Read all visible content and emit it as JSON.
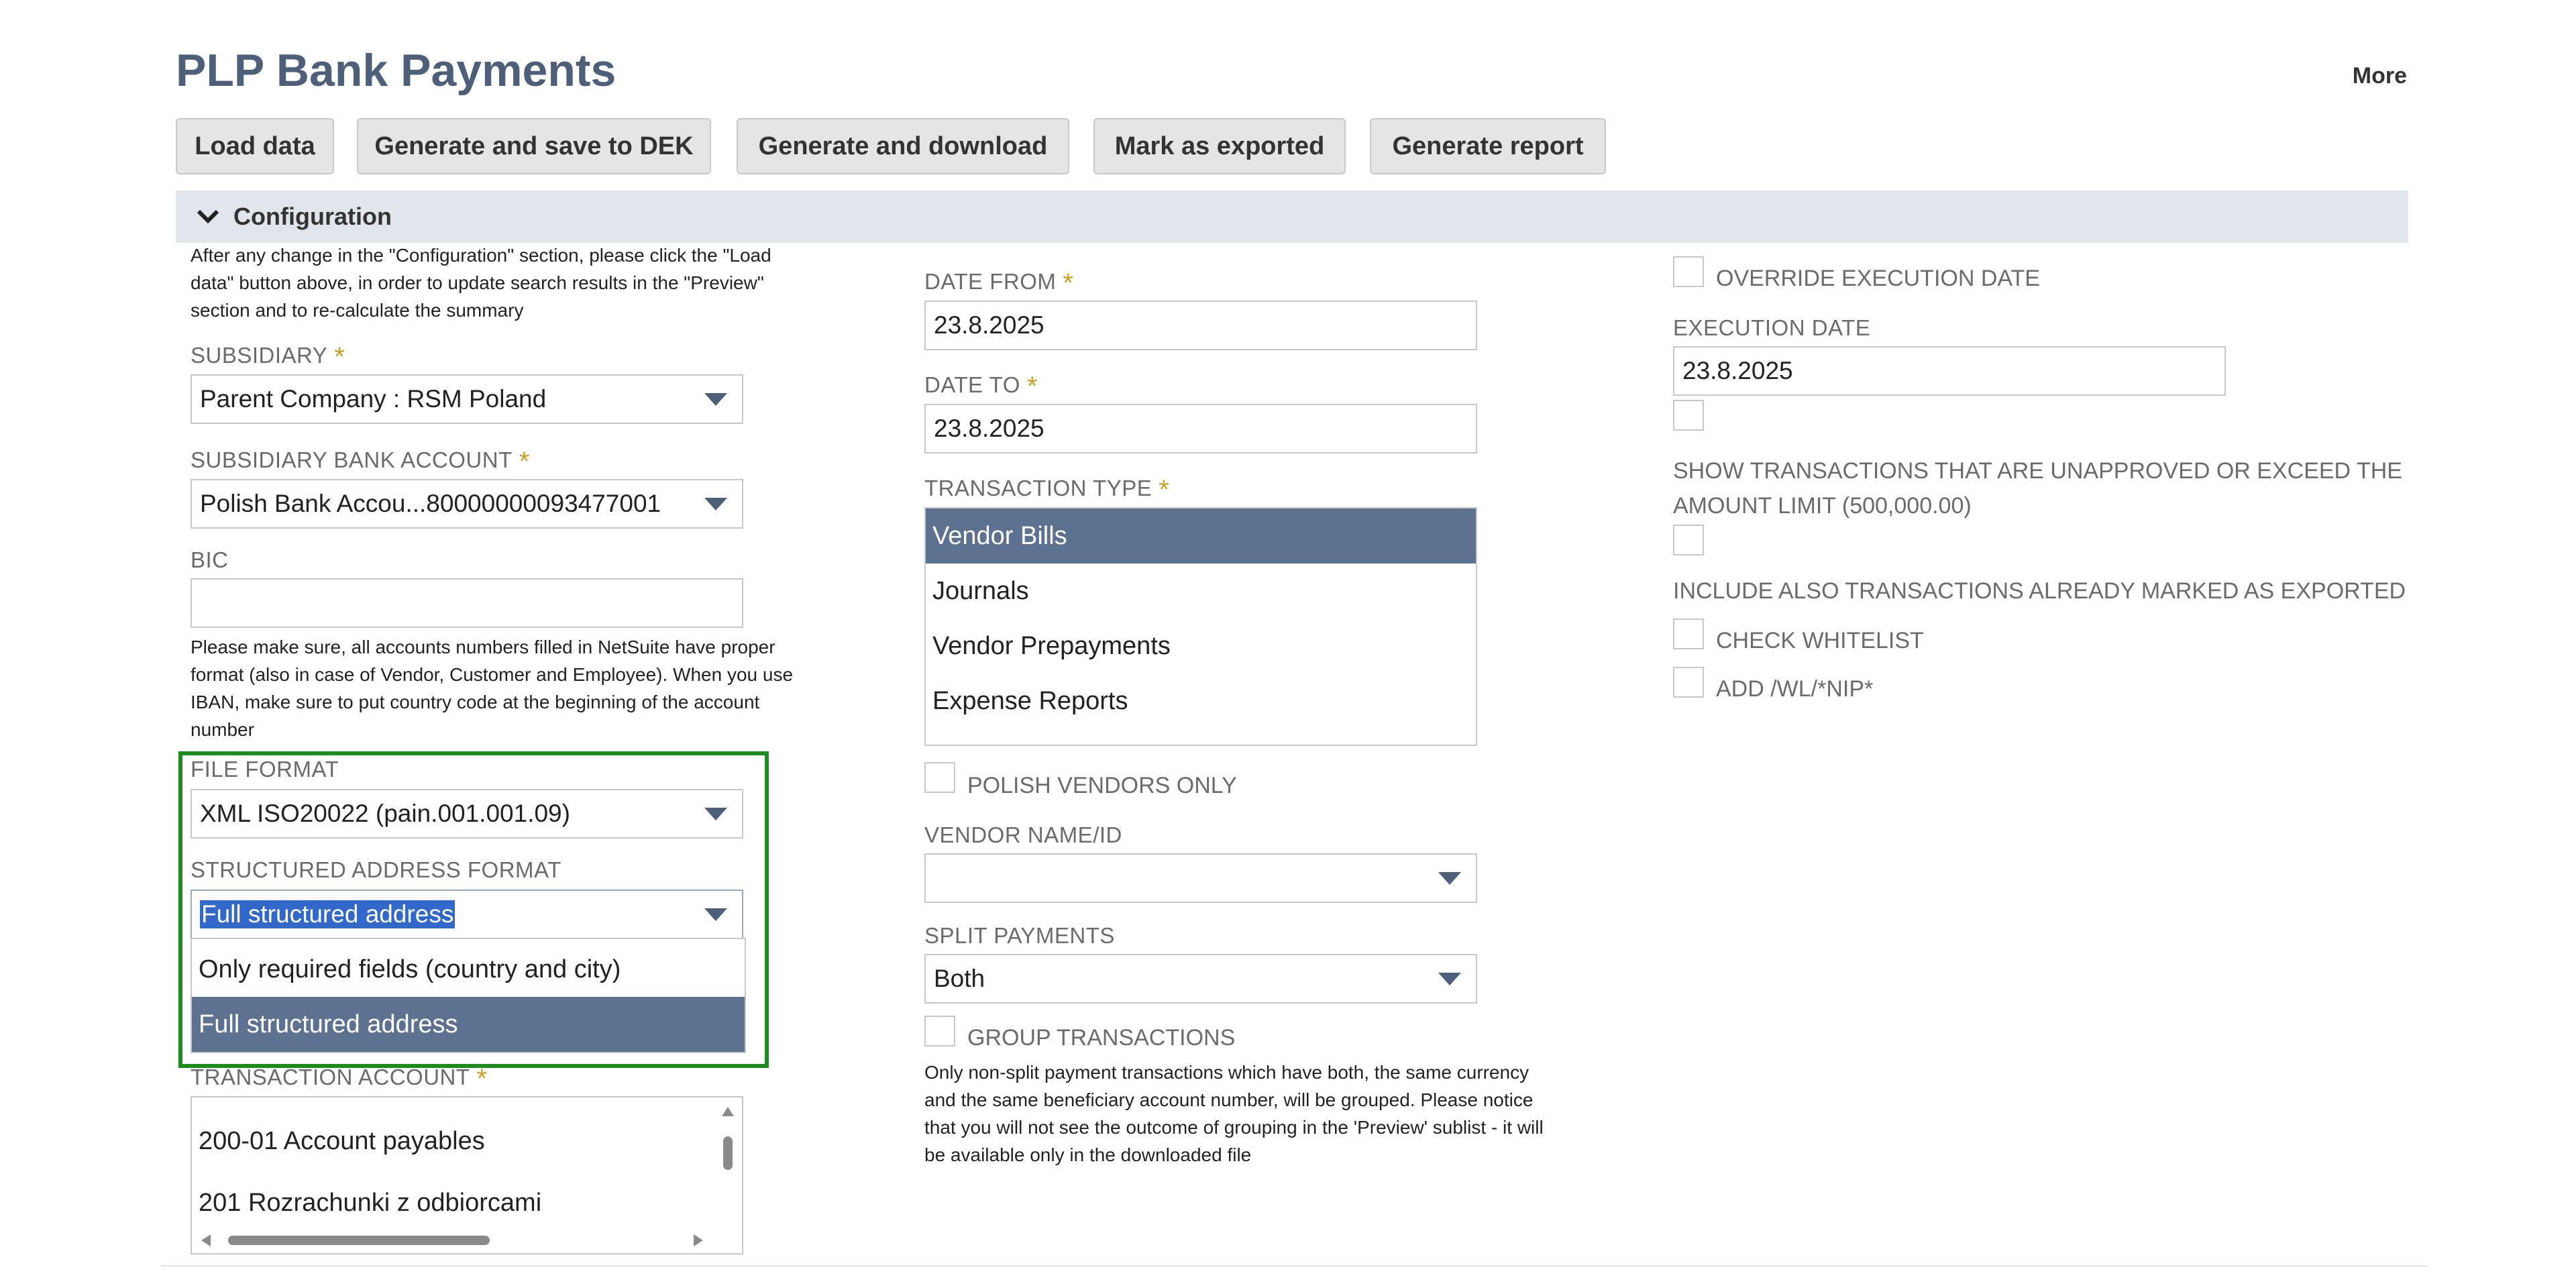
{
  "header": {
    "title": "PLP Bank Payments",
    "more_label": "More"
  },
  "toolbar": {
    "buttons": [
      "Load data",
      "Generate and save to DEK",
      "Generate and download",
      "Mark as exported",
      "Generate report"
    ]
  },
  "section": {
    "label": "Configuration",
    "icon": "chevron-down-icon"
  },
  "col1": {
    "note_lines": [
      "After any change in the \"Configuration\" section, please click the \"Load",
      "data\" button above, in order to update search results in the \"Preview\"",
      "section and to re-calculate the summary"
    ],
    "subsidiary": {
      "label": "SUBSIDIARY",
      "value": "Parent Company : RSM Poland"
    },
    "bank_account": {
      "label": "SUBSIDIARY BANK ACCOUNT",
      "value": "Polish Bank Accou...80000000093477001"
    },
    "bic": {
      "label": "BIC",
      "value": ""
    },
    "account_note_lines": [
      "Please make sure, all accounts numbers filled in NetSuite have proper",
      "format (also in case of Vendor, Customer and Employee). When you use",
      "IBAN, make sure to put country code at the beginning of the account",
      "number"
    ],
    "file_format": {
      "label": "FILE FORMAT",
      "value": "XML ISO20022 (pain.001.001.09)"
    },
    "structured_address": {
      "label": "STRUCTURED ADDRESS FORMAT",
      "value": "Full structured address",
      "options": [
        "Only required fields (country and city)",
        "Full structured address"
      ]
    },
    "transaction_account": {
      "label": "TRANSACTION ACCOUNT",
      "items": [
        "200-01 Account payables",
        "201 Rozrachunki z odbiorcami"
      ]
    }
  },
  "col2": {
    "date_from": {
      "label": "DATE FROM",
      "value": "23.8.2025"
    },
    "date_to": {
      "label": "DATE TO",
      "value": "23.8.2025"
    },
    "transaction_type": {
      "label": "TRANSACTION TYPE",
      "items": [
        "Vendor Bills",
        "Journals",
        "Vendor Prepayments",
        "Expense Reports"
      ],
      "selected": "Vendor Bills"
    },
    "polish_vendors_label": "POLISH VENDORS ONLY",
    "vendor_name": {
      "label": "VENDOR NAME/ID",
      "value": ""
    },
    "split_payments": {
      "label": "SPLIT PAYMENTS",
      "value": "Both"
    },
    "group_transactions_label": "GROUP TRANSACTIONS",
    "group_note_lines": [
      "Only non-split payment transactions which have both, the same currency",
      "and the same beneficiary account number, will be grouped. Please notice",
      "that you will not see the outcome of grouping in the 'Preview' sublist - it will",
      "be available only in the downloaded file"
    ]
  },
  "col3": {
    "override_label": "OVERRIDE EXECUTION DATE",
    "execution_date": {
      "label": "EXECUTION DATE",
      "value": "23.8.2025"
    },
    "show_unapproved_lines": [
      "SHOW TRANSACTIONS THAT ARE UNAPPROVED OR EXCEED THE",
      "AMOUNT LIMIT (500,000.00)"
    ],
    "include_exported_label": "INCLUDE ALSO TRANSACTIONS ALREADY MARKED AS EXPORTED",
    "check_whitelist_label": "CHECK WHITELIST",
    "add_wl_label": "ADD /WL/*NIP*"
  },
  "colors": {
    "title": "#4d5f79",
    "selected": "#5d7191",
    "highlight": "#1f8a1f",
    "required": "#c9a227"
  }
}
